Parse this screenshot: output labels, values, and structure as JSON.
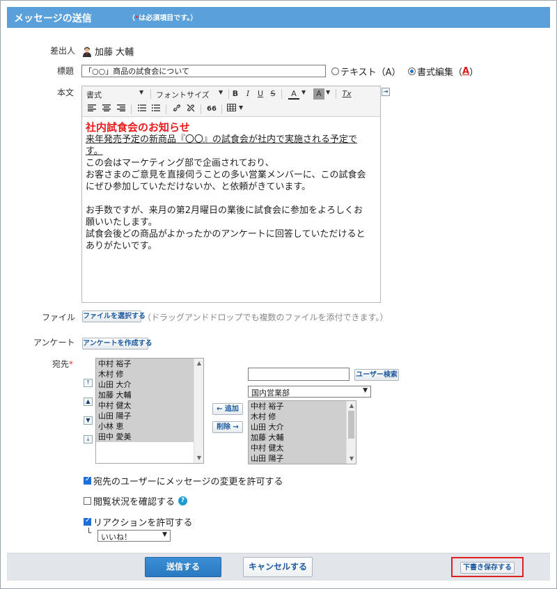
{
  "header": {
    "title": "メッセージの送信",
    "note_open": "（",
    "note_star": "*",
    "note_text": "は必須項目です。）"
  },
  "sender": {
    "label": "差出人",
    "name": "加藤 大輔"
  },
  "subject": {
    "label": "標題",
    "value": "「○○」商品の試食会について",
    "format_options": [
      {
        "label": "テキスト（A）",
        "selected": false
      },
      {
        "label": "書式編集（",
        "selected": true
      }
    ],
    "format_icon": "A",
    "format_close": "）"
  },
  "body": {
    "label": "本文",
    "toolbar": {
      "style_select": "書式",
      "font_size_select": "フォントサイズ",
      "bold": "B",
      "italic": "I",
      "underline": "U",
      "strike": "S",
      "text_color": "A",
      "bg_color": "A",
      "clear_format": "Tx",
      "quote": "66"
    },
    "content": {
      "heading": "社内試食会のお知らせ",
      "underlined": "来年発売予定の新商品『〇〇』の試食会が社内で実施される予定です。",
      "lines1": [
        "この会はマーケティング部で企画されており、",
        "お客さまのご意見を直接伺うことの多い営業メンバーに、この試食会にぜひ参加していただけないか、と依頼がきています。"
      ],
      "lines2": [
        "お手数ですが、来月の第2月曜日の業後に試食会に参加をよろしくお願いいたします。",
        "試食会後どの商品がよかったかのアンケートに回答していただけるとありがたいです。"
      ]
    }
  },
  "file": {
    "label": "ファイル",
    "button": "ファイルを選択する",
    "hint": "（ドラッグアンドドロップでも複数のファイルを添付できます。）"
  },
  "survey": {
    "label": "アンケート",
    "button": "アンケートを作成する"
  },
  "recipients": {
    "label": "宛先",
    "required_mark": "*",
    "selected": [
      "中村 裕子",
      "木村 修",
      "山田 大介",
      "加藤 大輔",
      "中村 健太",
      "山田 陽子",
      "小林 恵",
      "田中 愛美"
    ],
    "search_placeholder": "",
    "search_button": "ユーザー検索",
    "group_select": "国内営業部",
    "candidates": [
      "中村 裕子",
      "木村 修",
      "山田 大介",
      "加藤 大輔",
      "中村 健太",
      "山田 陽子"
    ],
    "add_button": "← 追加",
    "remove_button": "削除 →"
  },
  "options": {
    "allow_edit": {
      "label": "宛先のユーザーにメッセージの変更を許可する",
      "checked": true
    },
    "read_status": {
      "label": "閲覧状況を確認する",
      "checked": false,
      "help": "?"
    },
    "reaction": {
      "label": "リアクションを許可する",
      "checked": true,
      "tree": "└",
      "select": "いいね！"
    }
  },
  "footer": {
    "send": "送信する",
    "cancel": "キャンセルする",
    "draft": "下書き保存する"
  }
}
